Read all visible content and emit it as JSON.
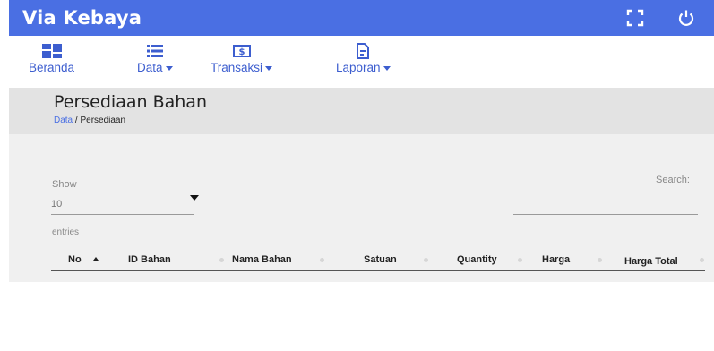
{
  "app": {
    "title": "Via Kebaya",
    "colors": {
      "primary": "#4a6fe3",
      "header_bg": "#e3e3e3",
      "content_bg": "#f0f0f0"
    },
    "icons": {
      "fullscreen": "fullscreen-icon",
      "power": "power-icon"
    }
  },
  "nav": {
    "items": [
      {
        "label": "Beranda",
        "icon": "dashboard-icon",
        "dropdown": false
      },
      {
        "label": "Data",
        "icon": "list-icon",
        "dropdown": true
      },
      {
        "label": "Transaksi",
        "icon": "money-icon",
        "dropdown": true
      },
      {
        "label": "Laporan",
        "icon": "document-icon",
        "dropdown": true
      }
    ]
  },
  "page": {
    "title": "Persediaan Bahan",
    "breadcrumb": {
      "link": "Data",
      "separator": " / ",
      "current": "Persediaan"
    }
  },
  "table_controls": {
    "show_label": "Show",
    "page_length": "10",
    "entries_label": "entries",
    "search_label": "Search:",
    "search_value": ""
  },
  "table": {
    "columns": [
      "No",
      "ID Bahan",
      "Nama Bahan",
      "Satuan",
      "Quantity",
      "Harga",
      "Harga Total"
    ],
    "sorted_column": "No",
    "sort_direction": "ascending",
    "rows": []
  }
}
